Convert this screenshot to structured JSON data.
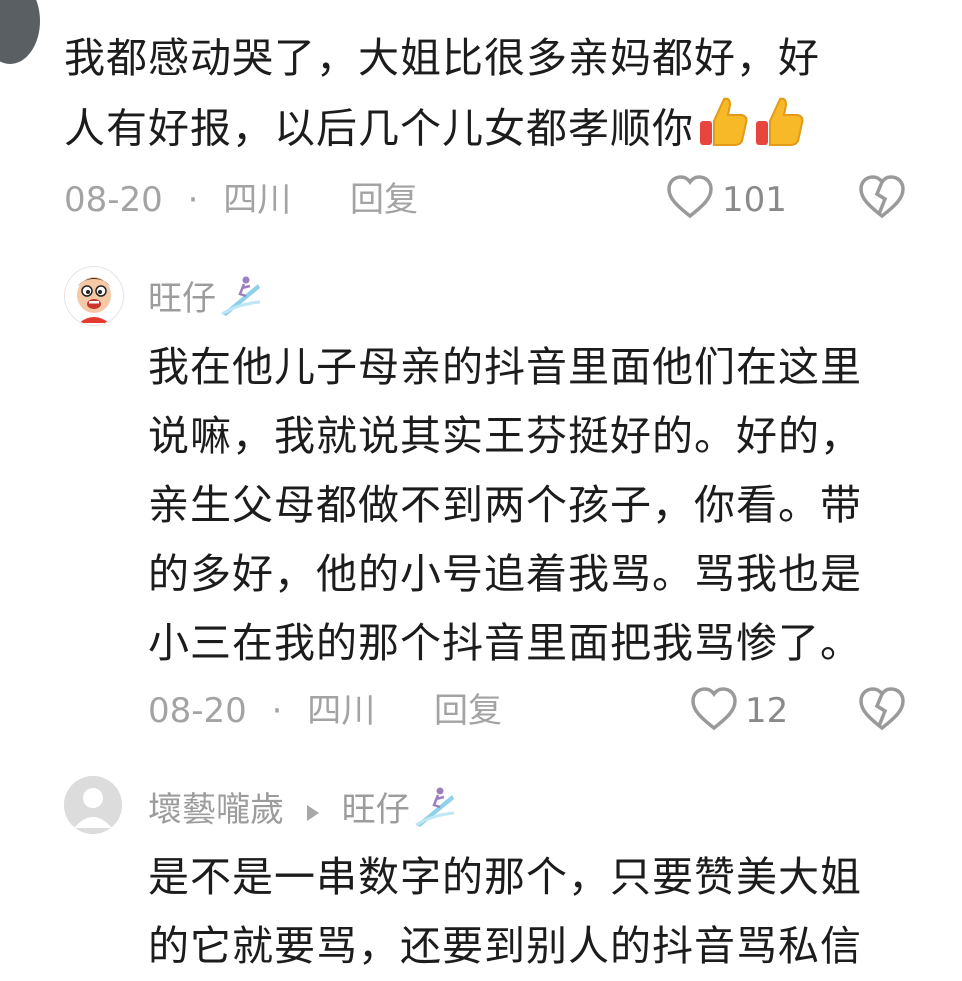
{
  "comments": [
    {
      "author": "",
      "text_lines": [
        "我都感动哭了，大姐比很多亲妈都好，好",
        "人有好报，以后几个儿女都孝顺你"
      ],
      "emoji": [
        "thumbs-up-emoji",
        "thumbs-up-emoji"
      ],
      "date": "08-20",
      "separator": "·",
      "location": "四川",
      "reply_label": "回复",
      "likes": "101"
    },
    {
      "author": "旺仔",
      "text_lines": [
        "我在他儿子母亲的抖音里面他们在这里",
        "说嘛，我就说其实王芬挺好的。好的，",
        "亲生父母都做不到两个孩子，你看。带",
        "的多好，他的小号追着我骂。骂我也是",
        "小三在我的那个抖音里面把我骂惨了。"
      ],
      "date": "08-20",
      "separator": "·",
      "location": "四川",
      "reply_label": "回复",
      "likes": "12"
    },
    {
      "author": "壞藝嚨歲",
      "reply_to": "旺仔",
      "text_lines": [
        "是不是一串数字的那个，只要赞美大姐",
        "的它就要骂，还要到别人的抖音骂私信"
      ]
    }
  ],
  "colors": {
    "text": "#1c1c1c",
    "meta": "#a3a3a3",
    "icon": "#9a9a9a"
  }
}
